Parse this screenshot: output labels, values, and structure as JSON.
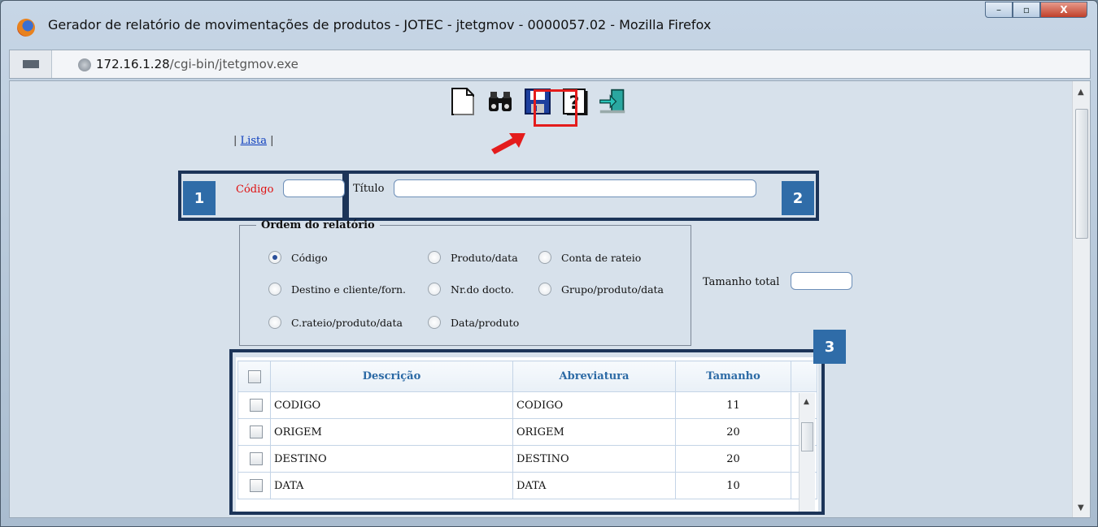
{
  "window": {
    "title": "Gerador de relatório de movimentações de produtos - JOTEC - jtetgmov - 0000057.02 - Mozilla Firefox",
    "minimize": "–",
    "maximize": "▫",
    "close": "X"
  },
  "url": {
    "host": "172.16.1.28",
    "path": "/cgi-bin/jtetgmov.exe"
  },
  "toolbar": {
    "icons": [
      "new-icon",
      "search-icon",
      "save-icon",
      "help-icon",
      "exit-icon"
    ]
  },
  "nav": {
    "sep_left": "|",
    "lista": "Lista",
    "sep_right": "|"
  },
  "form": {
    "codigo_label": "Código",
    "codigo_value": "",
    "titulo_label": "Título",
    "titulo_value": "",
    "tamanho_label": "Tamanho total",
    "tamanho_value": ""
  },
  "order": {
    "legend": "Ordem do relatório",
    "options": [
      {
        "label": "Código",
        "selected": true
      },
      {
        "label": "Produto/data",
        "selected": false
      },
      {
        "label": "Conta de rateio",
        "selected": false
      },
      {
        "label": "Destino e cliente/forn.",
        "selected": false
      },
      {
        "label": "Nr.do docto.",
        "selected": false
      },
      {
        "label": "Grupo/produto/data",
        "selected": false
      },
      {
        "label": "C.rateio/produto/data",
        "selected": false
      },
      {
        "label": "Data/produto",
        "selected": false
      }
    ]
  },
  "markers": {
    "m1": "1",
    "m2": "2",
    "m3": "3"
  },
  "table": {
    "headers": [
      "Descrição",
      "Abreviatura",
      "Tamanho"
    ],
    "rows": [
      {
        "descricao": "CODIGO",
        "abreviatura": "CODIGO",
        "tamanho": "11"
      },
      {
        "descricao": "ORIGEM",
        "abreviatura": "ORIGEM",
        "tamanho": "20"
      },
      {
        "descricao": "DESTINO",
        "abreviatura": "DESTINO",
        "tamanho": "20"
      },
      {
        "descricao": "DATA",
        "abreviatura": "DATA",
        "tamanho": "10"
      }
    ]
  },
  "colors": {
    "highlight": "#e41c1c",
    "marker_box": "#1c3458",
    "marker_fill": "#2f6ca8"
  }
}
